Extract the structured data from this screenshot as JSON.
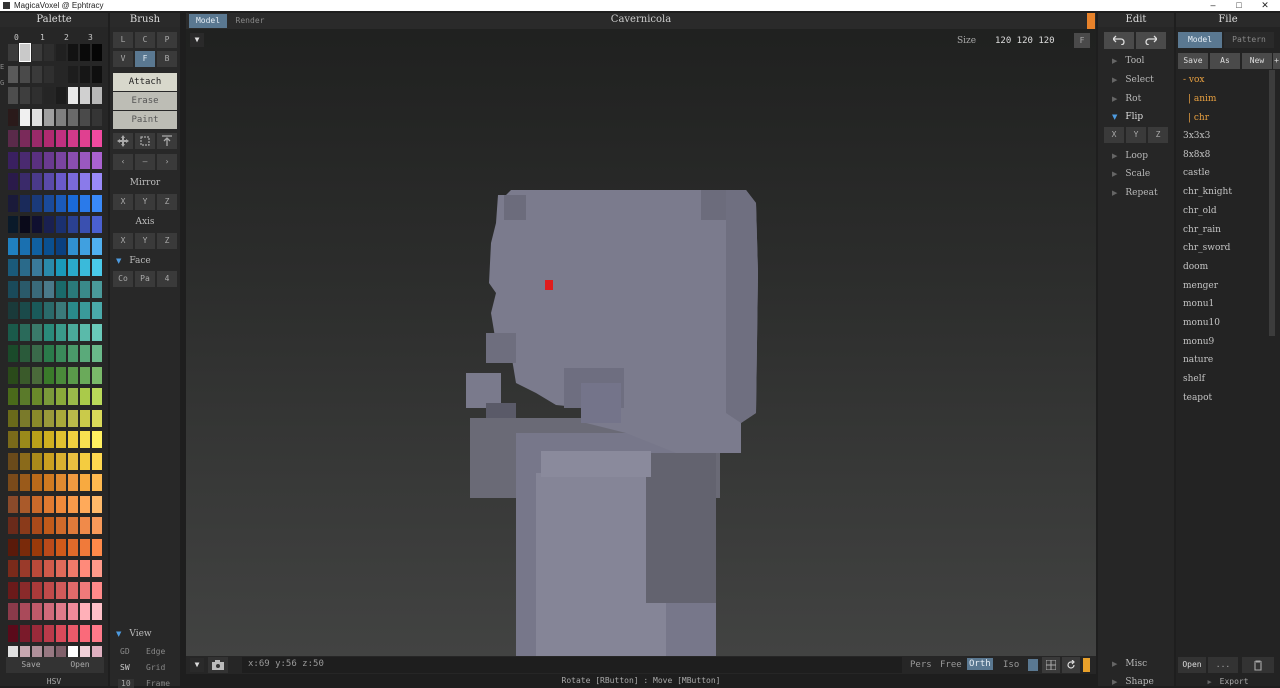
{
  "window": {
    "title": "MagicaVoxel @ Ephtracy",
    "controls": [
      "–",
      "□",
      "✕"
    ]
  },
  "palette": {
    "header": "Palette",
    "tabs": [
      "0",
      "1",
      "2",
      "3"
    ],
    "side_markers": [
      "E",
      "G"
    ],
    "save_label": "Save",
    "open_label": "Open",
    "mode_label": "HSV",
    "colors": [
      [
        "#3b3b3b",
        "#c9c9c9",
        "#3a3a3a",
        "#2e2e2e",
        "#202020",
        "#121212",
        "#0a0a0a",
        "#050505"
      ],
      [
        "#5a5a5a",
        "#4a4a4a",
        "#3a3a3a",
        "#2f2f2f",
        "#262626",
        "#1d1d1d",
        "#161616",
        "#0f0f0f"
      ],
      [
        "#4d4d4d",
        "#3e3e3e",
        "#2f2f2f",
        "#252525",
        "#1c1c1c",
        "#e8e8e8",
        "#d0d0d0",
        "#b8b8b8"
      ],
      [
        "#2a1a1a",
        "#f0f0f0",
        "#e0e0e0",
        "#a0a0a0",
        "#808080",
        "#6a6a6a",
        "#4a4a4a",
        "#353535"
      ],
      [
        "#5a2a4a",
        "#7a2a5a",
        "#9a2a6a",
        "#b02a70",
        "#c03080",
        "#d03a8a",
        "#e04090",
        "#f04aa0"
      ],
      [
        "#3a2060",
        "#4a2a70",
        "#5a3080",
        "#6a3a90",
        "#7a44a0",
        "#8a4eb0",
        "#9a58c0",
        "#aa62d0"
      ],
      [
        "#2a1a4a",
        "#3a2a6a",
        "#4a3a8a",
        "#5a4aaa",
        "#6a5aca",
        "#7a6ada",
        "#8a7aea",
        "#9a8afa"
      ],
      [
        "#1a1a3a",
        "#1a2a5a",
        "#1a3a7a",
        "#1a4a9a",
        "#1a5aba",
        "#1a6ada",
        "#2a7aea",
        "#3a8afa"
      ],
      [
        "#0a1a2a",
        "#0a0a1a",
        "#101030",
        "#1a2050",
        "#1a3070",
        "#2a4090",
        "#3a50b0",
        "#4a60d0"
      ],
      [
        "#2080c0",
        "#1a70b0",
        "#1060a0",
        "#0a5090",
        "#0a4080",
        "#3090d0",
        "#40a0e0",
        "#50b0f0"
      ],
      [
        "#1a5a7a",
        "#2a6a8a",
        "#3a7a9a",
        "#2a8aaa",
        "#1a9aba",
        "#2aaaca",
        "#3abada",
        "#4acaea"
      ],
      [
        "#1a4a5a",
        "#2a5a6a",
        "#3a6a7a",
        "#4a7a8a",
        "#1a6a6a",
        "#2a7a7a",
        "#3a8a8a",
        "#4a9a9a"
      ],
      [
        "#1a3a3a",
        "#1a4a4a",
        "#1a5a5a",
        "#2a6a6a",
        "#3a7a7a",
        "#2a8a8a",
        "#3a9a9a",
        "#4aaaaa"
      ],
      [
        "#1a5a4a",
        "#2a6a5a",
        "#3a7a6a",
        "#2a8a7a",
        "#3a9a8a",
        "#4aaa9a",
        "#5abaaa",
        "#6acaba"
      ],
      [
        "#1a4a2a",
        "#2a5a3a",
        "#3a6a4a",
        "#2a7a4a",
        "#3a8a5a",
        "#4a9a6a",
        "#5aaa7a",
        "#6aba8a"
      ],
      [
        "#2a4a1a",
        "#3a5a2a",
        "#4a6a3a",
        "#3a7a2a",
        "#4a8a3a",
        "#5a9a4a",
        "#6aaa5a",
        "#7aba6a"
      ],
      [
        "#4a6a1a",
        "#5a7a2a",
        "#6a8a2a",
        "#7a9a3a",
        "#8aaa3a",
        "#9aba4a",
        "#aaca4a",
        "#bada5a"
      ],
      [
        "#6a6a1a",
        "#7a7a2a",
        "#8a8a2a",
        "#9a9a3a",
        "#aaaa3a",
        "#baba4a",
        "#caca4a",
        "#dada5a"
      ],
      [
        "#7a6a1a",
        "#9a8a1a",
        "#baa01a",
        "#d0b020",
        "#e0c030",
        "#f0d040",
        "#f8e050",
        "#fff060"
      ],
      [
        "#6a4a1a",
        "#8a6a1a",
        "#aa8a1a",
        "#caa020",
        "#dab030",
        "#eac040",
        "#f4cc40",
        "#ffd850"
      ],
      [
        "#7a4a1a",
        "#9a5a1a",
        "#ba6a1a",
        "#d07a20",
        "#e08a30",
        "#f09a40",
        "#f8aa40",
        "#ffba50"
      ],
      [
        "#8a4a2a",
        "#aa5a2a",
        "#ca6a2a",
        "#e07a30",
        "#f08a3a",
        "#f89a4a",
        "#ffaa5a",
        "#ffba6a"
      ],
      [
        "#6a2a1a",
        "#8a3a1a",
        "#aa4a1a",
        "#c05a1a",
        "#d06a2a",
        "#e07a3a",
        "#f08a4a",
        "#f89a5a"
      ],
      [
        "#5a1a0a",
        "#7a2a0a",
        "#9a3a0a",
        "#ba4a1a",
        "#d05a1a",
        "#e06a2a",
        "#f07a3a",
        "#ff8a4a"
      ],
      [
        "#7a2a1a",
        "#9a3a2a",
        "#ba4a3a",
        "#d05a4a",
        "#e06a5a",
        "#f07a6a",
        "#ff8a7a",
        "#ff9a8a"
      ],
      [
        "#6a1a1a",
        "#8a2a2a",
        "#aa3a3a",
        "#c04a4a",
        "#d05a5a",
        "#e06a6a",
        "#f07a7a",
        "#ff8a8a"
      ],
      [
        "#8a3a4a",
        "#aa4a5a",
        "#c05a6a",
        "#d06a7a",
        "#e07a8a",
        "#f08a9a",
        "#ffb0b8",
        "#ffc0c8"
      ],
      [
        "#5a0a1a",
        "#7a1a2a",
        "#9a2a3a",
        "#ba3a4a",
        "#da4a5a",
        "#ea5a6a",
        "#fa6a7a",
        "#ff7a8a"
      ],
      [
        "#e0e0e0",
        "#c8a8b0",
        "#b0909a",
        "#987882",
        "#80606a",
        "#ffffff",
        "#f0d0d8",
        "#e0b0c0"
      ]
    ]
  },
  "brush": {
    "header": "Brush",
    "row1": [
      "L",
      "C",
      "P"
    ],
    "row2": [
      "V",
      "F",
      "B"
    ],
    "row2_active": "F",
    "modes": [
      "Attach",
      "Erase",
      "Paint"
    ],
    "transform_icons": [
      "move-icon",
      "select-box-icon",
      "anchor-icon"
    ],
    "nav_icons": [
      "‹",
      "–",
      "›"
    ],
    "mirror_label": "Mirror",
    "mirror_axes": [
      "X",
      "Y",
      "Z"
    ],
    "axis_label": "Axis",
    "axis_axes": [
      "X",
      "Y",
      "Z"
    ],
    "face_label": "Face",
    "face_buttons": [
      "Co",
      "Pa",
      "4"
    ],
    "view_label": "View",
    "view_items": [
      [
        "GD",
        "Edge"
      ],
      [
        "SW",
        "Grid"
      ],
      [
        "10",
        "Frame"
      ]
    ]
  },
  "viewport": {
    "tabs": [
      "Model",
      "Render"
    ],
    "active_tab": "Model",
    "title": "Cavernicola",
    "size_label": "Size",
    "size_values": "120 120 120",
    "size_btn": "F",
    "coords": "x:69  y:56  z:50",
    "proj_modes": [
      "Pers",
      "Free",
      "Orth",
      "Iso"
    ],
    "active_proj": "Orth",
    "status": "Rotate [RButton] : Move [MButton]",
    "accent": "#e8822a"
  },
  "edit": {
    "header": "Edit",
    "undo_icon": "undo-icon",
    "redo_icon": "redo-icon",
    "items": [
      "Tool",
      "Select",
      "Rot",
      "Flip",
      "Loop",
      "Scale",
      "Repeat"
    ],
    "open_item": "Flip",
    "flip_axes": [
      "X",
      "Y",
      "Z"
    ],
    "bottom_items": [
      "Misc",
      "Shape"
    ]
  },
  "file": {
    "header": "File",
    "tabs": [
      "Model",
      "Pattern"
    ],
    "active_tab": "Model",
    "actions": [
      "Save",
      "As",
      "New"
    ],
    "folders": [
      "- vox",
      "| anim",
      "| chr"
    ],
    "files": [
      "3x3x3",
      "8x8x8",
      "castle",
      "chr_knight",
      "chr_old",
      "chr_rain",
      "chr_sword",
      "doom",
      "menger",
      "monu1",
      "monu10",
      "monu9",
      "nature",
      "shelf",
      "teapot"
    ],
    "open_label": "Open",
    "more_label": "...",
    "export_label": "Export"
  }
}
